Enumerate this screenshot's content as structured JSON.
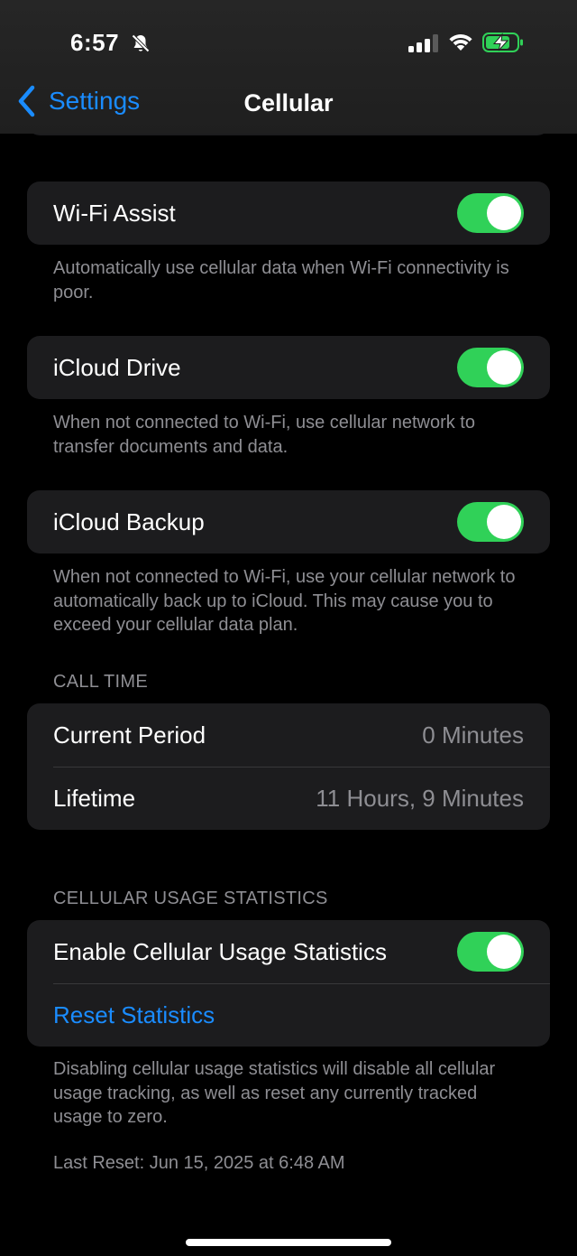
{
  "status_bar": {
    "time": "6:57"
  },
  "nav": {
    "back_label": "Settings",
    "title": "Cellular"
  },
  "wifi_assist": {
    "label": "Wi-Fi Assist",
    "on": true,
    "footer": "Automatically use cellular data when Wi-Fi connectivity is poor."
  },
  "icloud_drive": {
    "label": "iCloud Drive",
    "on": true,
    "footer": "When not connected to Wi-Fi, use cellular network to transfer documents and data."
  },
  "icloud_backup": {
    "label": "iCloud Backup",
    "on": true,
    "footer": "When not connected to Wi-Fi, use your cellular network to automatically back up to iCloud. This may cause you to exceed your cellular data plan."
  },
  "call_time": {
    "header": "CALL TIME",
    "rows": [
      {
        "label": "Current Period",
        "value": "0 Minutes"
      },
      {
        "label": "Lifetime",
        "value": "11 Hours, 9 Minutes"
      }
    ]
  },
  "usage_stats": {
    "header": "CELLULAR USAGE STATISTICS",
    "enable_label": "Enable Cellular Usage Statistics",
    "enable_on": true,
    "reset_label": "Reset Statistics",
    "footer": "Disabling cellular usage statistics will disable all cellular usage tracking, as well as reset any currently tracked usage to zero.",
    "last_reset": "Last Reset: Jun 15, 2025 at 6:48 AM"
  },
  "colors": {
    "accent": "#1a8cff",
    "toggle_on": "#30d158",
    "group_bg": "#1c1c1e",
    "secondary_text": "#8e8e93"
  },
  "icons": [
    "bell-slash-icon",
    "cellular-signal-icon",
    "wifi-icon",
    "battery-charging-icon",
    "chevron-left-icon"
  ]
}
